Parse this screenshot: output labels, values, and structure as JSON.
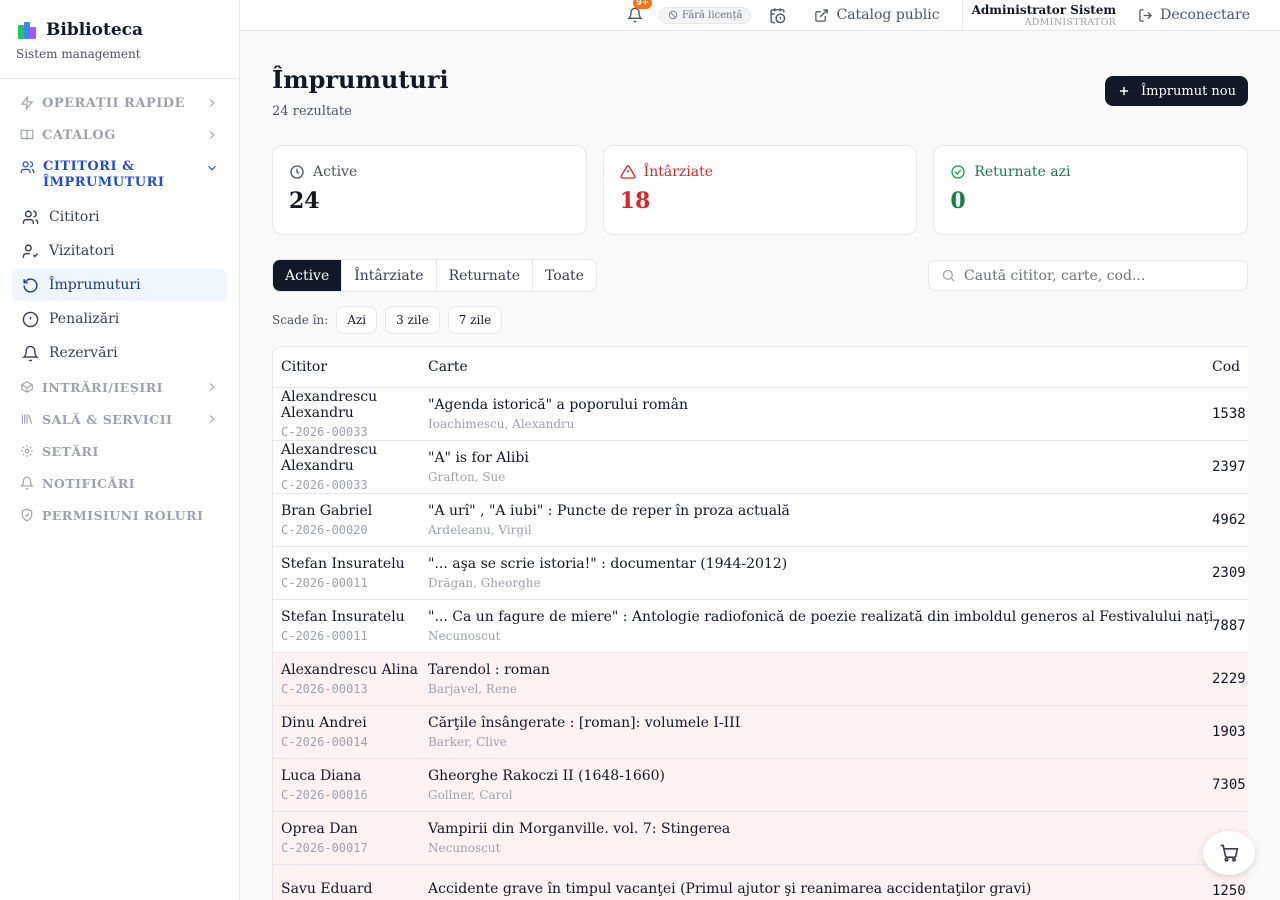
{
  "brand": {
    "title": "Biblioteca",
    "subtitle": "Sistem management"
  },
  "sidebar": {
    "sections_top": [
      {
        "label": "OPERAȚII RAPIDE",
        "icon": "lightning-icon"
      },
      {
        "label": "CATALOG",
        "icon": "book-open-icon"
      }
    ],
    "open_section": {
      "label": "CITITORI & ÎMPRUMUTURI",
      "icon": "users-icon"
    },
    "items": [
      {
        "label": "Cititori",
        "icon": "users-icon"
      },
      {
        "label": "Vizitatori",
        "icon": "user-check-icon"
      },
      {
        "label": "Împrumuturi",
        "icon": "rotate-icon",
        "active": true
      },
      {
        "label": "Penalizări",
        "icon": "alert-circle-icon"
      },
      {
        "label": "Rezervări",
        "icon": "bell-icon"
      }
    ],
    "sections_bottom": [
      {
        "label": "INTRĂRI/IEȘIRI",
        "icon": "box-icon",
        "chevron": true
      },
      {
        "label": "SALĂ & SERVICII",
        "icon": "library-icon",
        "chevron": true
      },
      {
        "label": "SETĂRI",
        "icon": "gear-icon",
        "chevron": false
      },
      {
        "label": "NOTIFICĂRI",
        "icon": "bell-icon",
        "chevron": false
      },
      {
        "label": "PERMISIUNI ROLURI",
        "icon": "shield-icon",
        "chevron": false
      }
    ]
  },
  "topbar": {
    "notifications_badge": "9+",
    "license": "Fără licență",
    "catalog_link": "Catalog public",
    "user_name": "Administrator Sistem",
    "user_role": "ADMINISTRATOR",
    "logout": "Deconectare"
  },
  "page": {
    "title": "Împrumuturi",
    "results": "24 rezultate",
    "new_button": "Împrumut nou"
  },
  "stats": [
    {
      "label": "Active",
      "value": "24",
      "color": "#111827",
      "label_color": "#4b5563",
      "icon": "clock-icon"
    },
    {
      "label": "Întârziate",
      "value": "18",
      "color": "#dc2626",
      "label_color": "#dc2626",
      "icon": "warning-icon"
    },
    {
      "label": "Returnate azi",
      "value": "0",
      "color": "#15803d",
      "label_color": "#15803d",
      "icon": "check-circle-icon"
    }
  ],
  "tabs": [
    "Active",
    "Întârziate",
    "Returnate",
    "Toate"
  ],
  "search": {
    "placeholder": "Caută cititor, carte, cod..."
  },
  "due": {
    "label": "Scade în:",
    "chips": [
      "Azi",
      "3 zile",
      "7 zile"
    ]
  },
  "table": {
    "columns": [
      "Cititor",
      "Carte",
      "Cod"
    ],
    "rows": [
      {
        "reader": "Alexandrescu Alexandru",
        "code": "C-2026-00033",
        "book": "\"Agenda istorică\" a poporului român",
        "author": "Ioachimescu, Alexandru",
        "item_code": "1538",
        "late": false
      },
      {
        "reader": "Alexandrescu Alexandru",
        "code": "C-2026-00033",
        "book": "\"A\" is for Alibi",
        "author": "Grafton, Sue",
        "item_code": "2397",
        "late": false
      },
      {
        "reader": "Bran Gabriel",
        "code": "C-2026-00020",
        "book": "\"A urî\" , \"A iubi\" : Puncte de reper în proza actuală",
        "author": "Ardeleanu, Virgil",
        "item_code": "4962",
        "late": false
      },
      {
        "reader": "Stefan Insuratelu",
        "code": "C-2026-00011",
        "book": "\"... aşa se scrie istoria!\" : documentar (1944-2012)",
        "author": "Drăgan, Gheorghe",
        "item_code": "2309",
        "late": false
      },
      {
        "reader": "Stefan Insuratelu",
        "code": "C-2026-00011",
        "book": "\"... Ca un fagure de miere\" : Antologie radiofonică de poezie realizată din imboldul generos al Festivalului naţional \"Cântarea României\"",
        "author": "Necunoscut",
        "item_code": "7887",
        "late": false
      },
      {
        "reader": "Alexandrescu Alina",
        "code": "C-2026-00013",
        "book": "Tarendol : roman",
        "author": "Barjavel, Rene",
        "item_code": "2229",
        "late": true
      },
      {
        "reader": "Dinu Andrei",
        "code": "C-2026-00014",
        "book": "Cărţile însângerate : [roman]: volumele I-III",
        "author": "Barker, Clive",
        "item_code": "1903",
        "late": true
      },
      {
        "reader": "Luca Diana",
        "code": "C-2026-00016",
        "book": "Gheorghe Rakoczi II (1648-1660)",
        "author": "Gollner, Carol",
        "item_code": "7305",
        "late": true
      },
      {
        "reader": "Oprea Dan",
        "code": "C-2026-00017",
        "book": "Vampirii din Morganville. vol. 7: Stingerea",
        "author": "Necunoscut",
        "item_code": "",
        "late": true
      },
      {
        "reader": "Savu Eduard",
        "code": "",
        "book": "Accidente grave în timpul vacanţei (Primul ajutor şi reanimarea accidentaţilor gravi)",
        "author": "",
        "item_code": "1250",
        "late": true
      }
    ]
  }
}
